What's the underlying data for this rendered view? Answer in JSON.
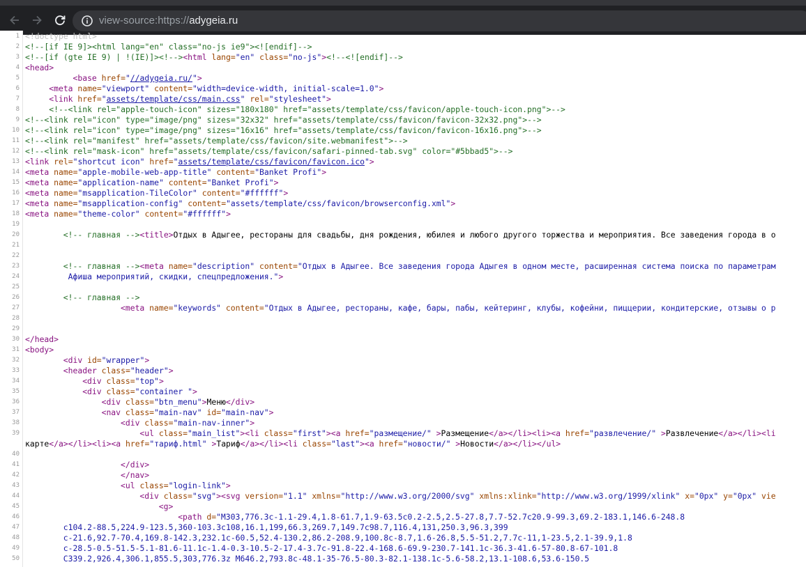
{
  "browser": {
    "url_prefix": "view-source:https://",
    "url_host": "adygeia.ru",
    "back_icon": "arrow-left-icon",
    "forward_icon": "arrow-right-icon",
    "reload_icon": "reload-icon",
    "info_icon": "info-icon"
  },
  "source_lines": [
    {
      "n": "1",
      "indent": 0,
      "parts": [
        [
          "dt",
          "<!doctype html>"
        ]
      ]
    },
    {
      "n": "2",
      "indent": 0,
      "parts": [
        [
          "cm",
          "<!--[if IE 9]><html lang=\"en\" class=\"no-js ie9\"><![endif]-->"
        ]
      ]
    },
    {
      "n": "3",
      "indent": 0,
      "parts": [
        [
          "cm",
          "<!--[if (gte IE 9) | !(IE)]><!-->"
        ],
        [
          "tag",
          "<html "
        ],
        [
          "an",
          "lang="
        ],
        [
          "av",
          "\"en\" "
        ],
        [
          "an",
          "class="
        ],
        [
          "av",
          "\"no-js\""
        ],
        [
          "tag",
          ">"
        ],
        [
          "cm",
          "<!--<![endif]-->"
        ]
      ]
    },
    {
      "n": "4",
      "indent": 0,
      "parts": [
        [
          "tag",
          "<head>"
        ]
      ]
    },
    {
      "n": "5",
      "indent": 10,
      "parts": [
        [
          "tag",
          "<base "
        ],
        [
          "an",
          "href="
        ],
        [
          "av",
          "\""
        ],
        [
          "lk",
          "//adygeia.ru/"
        ],
        [
          "av",
          "\""
        ],
        [
          "tag",
          ">"
        ]
      ]
    },
    {
      "n": "6",
      "indent": 5,
      "parts": [
        [
          "tag",
          "<meta "
        ],
        [
          "an",
          "name="
        ],
        [
          "av",
          "\"viewport\" "
        ],
        [
          "an",
          "content="
        ],
        [
          "av",
          "\"width=device-width, initial-scale=1.0\""
        ],
        [
          "tag",
          ">"
        ]
      ]
    },
    {
      "n": "7",
      "indent": 5,
      "parts": [
        [
          "tag",
          "<link "
        ],
        [
          "an",
          "href="
        ],
        [
          "av",
          "\""
        ],
        [
          "lk",
          "assets/template/css/main.css"
        ],
        [
          "av",
          "\" "
        ],
        [
          "an",
          "rel="
        ],
        [
          "av",
          "\"stylesheet\""
        ],
        [
          "tag",
          ">"
        ]
      ]
    },
    {
      "n": "8",
      "indent": 5,
      "parts": [
        [
          "cm",
          "<!--<link rel=\"apple-touch-icon\" sizes=\"180x180\" href=\"assets/template/css/favicon/apple-touch-icon.png\">-->"
        ]
      ]
    },
    {
      "n": "9",
      "indent": 0,
      "parts": [
        [
          "cm",
          "<!--<link rel=\"icon\" type=\"image/png\" sizes=\"32x32\" href=\"assets/template/css/favicon/favicon-32x32.png\">-->"
        ]
      ]
    },
    {
      "n": "10",
      "indent": 0,
      "parts": [
        [
          "cm",
          "<!--<link rel=\"icon\" type=\"image/png\" sizes=\"16x16\" href=\"assets/template/css/favicon/favicon-16x16.png\">-->"
        ]
      ]
    },
    {
      "n": "11",
      "indent": 0,
      "parts": [
        [
          "cm",
          "<!--<link rel=\"manifest\" href=\"assets/template/css/favicon/site.webmanifest\">-->"
        ]
      ]
    },
    {
      "n": "12",
      "indent": 0,
      "parts": [
        [
          "cm",
          "<!--<link rel=\"mask-icon\" href=\"assets/template/css/favicon/safari-pinned-tab.svg\" color=\"#5bbad5\">-->"
        ]
      ]
    },
    {
      "n": "13",
      "indent": 0,
      "parts": [
        [
          "tag",
          "<link "
        ],
        [
          "an",
          "rel="
        ],
        [
          "av",
          "\"shortcut icon\" "
        ],
        [
          "an",
          "href="
        ],
        [
          "av",
          "\""
        ],
        [
          "lk",
          "assets/template/css/favicon/favicon.ico"
        ],
        [
          "av",
          "\""
        ],
        [
          "tag",
          ">"
        ]
      ]
    },
    {
      "n": "14",
      "indent": 0,
      "parts": [
        [
          "tag",
          "<meta "
        ],
        [
          "an",
          "name="
        ],
        [
          "av",
          "\"apple-mobile-web-app-title\" "
        ],
        [
          "an",
          "content="
        ],
        [
          "av",
          "\"Banket Profi\""
        ],
        [
          "tag",
          ">"
        ]
      ]
    },
    {
      "n": "15",
      "indent": 0,
      "parts": [
        [
          "tag",
          "<meta "
        ],
        [
          "an",
          "name="
        ],
        [
          "av",
          "\"application-name\" "
        ],
        [
          "an",
          "content="
        ],
        [
          "av",
          "\"Banket Profi\""
        ],
        [
          "tag",
          ">"
        ]
      ]
    },
    {
      "n": "16",
      "indent": 0,
      "parts": [
        [
          "tag",
          "<meta "
        ],
        [
          "an",
          "name="
        ],
        [
          "av",
          "\"msapplication-TileColor\" "
        ],
        [
          "an",
          "content="
        ],
        [
          "av",
          "\"#ffffff\""
        ],
        [
          "tag",
          ">"
        ]
      ]
    },
    {
      "n": "17",
      "indent": 0,
      "parts": [
        [
          "tag",
          "<meta "
        ],
        [
          "an",
          "name="
        ],
        [
          "av",
          "\"msapplication-config\" "
        ],
        [
          "an",
          "content="
        ],
        [
          "av",
          "\"assets/template/css/favicon/browserconfig.xml\""
        ],
        [
          "tag",
          ">"
        ]
      ]
    },
    {
      "n": "18",
      "indent": 0,
      "parts": [
        [
          "tag",
          "<meta "
        ],
        [
          "an",
          "name="
        ],
        [
          "av",
          "\"theme-color\" "
        ],
        [
          "an",
          "content="
        ],
        [
          "av",
          "\"#ffffff\""
        ],
        [
          "tag",
          ">"
        ]
      ]
    },
    {
      "n": "19",
      "indent": 0,
      "parts": []
    },
    {
      "n": "20",
      "indent": 8,
      "parts": [
        [
          "cm",
          "<!-- главная -->"
        ],
        [
          "tag",
          "<title>"
        ],
        [
          "tx",
          "Отдых в Адыгее, рестораны для свадьбы, дня рождения, юбилея и любого другого торжества и мероприятия. Все заведения города в о"
        ]
      ]
    },
    {
      "n": "21",
      "indent": 0,
      "parts": []
    },
    {
      "n": "22",
      "indent": 0,
      "parts": []
    },
    {
      "n": "23",
      "indent": 8,
      "parts": [
        [
          "cm",
          "<!-- главная -->"
        ],
        [
          "tag",
          "<meta "
        ],
        [
          "an",
          "name="
        ],
        [
          "av",
          "\"description\" "
        ],
        [
          "an",
          "content="
        ],
        [
          "av",
          "\"Отдых в Адыгее. Все заведения города Адыгея в одном месте, расширенная система поиска по параметрам"
        ]
      ]
    },
    {
      "n": "24",
      "indent": 9,
      "parts": [
        [
          "av",
          "Афиша мероприятий, скидки, спецпредложения.\""
        ],
        [
          "tag",
          ">"
        ]
      ]
    },
    {
      "n": "25",
      "indent": 0,
      "parts": []
    },
    {
      "n": "26",
      "indent": 8,
      "parts": [
        [
          "cm",
          "<!-- главная -->"
        ]
      ]
    },
    {
      "n": "27",
      "indent": 20,
      "parts": [
        [
          "tag",
          "<meta "
        ],
        [
          "an",
          "name="
        ],
        [
          "av",
          "\"keywords\" "
        ],
        [
          "an",
          "content="
        ],
        [
          "av",
          "\"Отдых в Адыгее, рестораны, кафе, бары, пабы, кейтеринг, клубы, кофейни, пиццерии, кондитерские, отзывы о р"
        ]
      ]
    },
    {
      "n": "28",
      "indent": 0,
      "parts": []
    },
    {
      "n": "29",
      "indent": 0,
      "parts": []
    },
    {
      "n": "30",
      "indent": 0,
      "parts": [
        [
          "tag",
          "</head>"
        ]
      ]
    },
    {
      "n": "31",
      "indent": 0,
      "parts": [
        [
          "tag",
          "<body>"
        ]
      ]
    },
    {
      "n": "32",
      "indent": 8,
      "parts": [
        [
          "tag",
          "<div "
        ],
        [
          "an",
          "id="
        ],
        [
          "av",
          "\"wrapper\""
        ],
        [
          "tag",
          ">"
        ]
      ]
    },
    {
      "n": "33",
      "indent": 8,
      "parts": [
        [
          "tag",
          "<header "
        ],
        [
          "an",
          "class="
        ],
        [
          "av",
          "\"header\""
        ],
        [
          "tag",
          ">"
        ]
      ]
    },
    {
      "n": "34",
      "indent": 12,
      "parts": [
        [
          "tag",
          "<div "
        ],
        [
          "an",
          "class="
        ],
        [
          "av",
          "\"top\""
        ],
        [
          "tag",
          ">"
        ]
      ]
    },
    {
      "n": "35",
      "indent": 12,
      "parts": [
        [
          "tag",
          "<div "
        ],
        [
          "an",
          "class="
        ],
        [
          "av",
          "\"container \""
        ],
        [
          "tag",
          ">"
        ]
      ]
    },
    {
      "n": "36",
      "indent": 16,
      "parts": [
        [
          "tag",
          "<div "
        ],
        [
          "an",
          "class="
        ],
        [
          "av",
          "\"btn_menu\""
        ],
        [
          "tag",
          ">"
        ],
        [
          "tx",
          "Меню"
        ],
        [
          "tag",
          "</div>"
        ]
      ]
    },
    {
      "n": "37",
      "indent": 16,
      "parts": [
        [
          "tag",
          "<nav "
        ],
        [
          "an",
          "class="
        ],
        [
          "av",
          "\"main-nav\" "
        ],
        [
          "an",
          "id="
        ],
        [
          "av",
          "\"main-nav\""
        ],
        [
          "tag",
          ">"
        ]
      ]
    },
    {
      "n": "38",
      "indent": 20,
      "parts": [
        [
          "tag",
          "<div "
        ],
        [
          "an",
          "class="
        ],
        [
          "av",
          "\"main-nav-inner\""
        ],
        [
          "tag",
          ">"
        ]
      ]
    },
    {
      "n": "39",
      "indent": 24,
      "parts": [
        [
          "tag",
          "<ul "
        ],
        [
          "an",
          "class="
        ],
        [
          "av",
          "\"main_list\""
        ],
        [
          "tag",
          "><li "
        ],
        [
          "an",
          "class="
        ],
        [
          "av",
          "\"first\""
        ],
        [
          "tag",
          "><a "
        ],
        [
          "an",
          "href="
        ],
        [
          "av",
          "\"размещение/\" "
        ],
        [
          "tag",
          ">"
        ],
        [
          "tx",
          "Размещение"
        ],
        [
          "tag",
          "</a></li><li><a "
        ],
        [
          "an",
          "href="
        ],
        [
          "av",
          "\"развлечение/\" "
        ],
        [
          "tag",
          ">"
        ],
        [
          "tx",
          "Развлечение"
        ],
        [
          "tag",
          "</a></li><li"
        ]
      ]
    },
    {
      "n": "",
      "indent": 0,
      "parts": [
        [
          "tx",
          "карте"
        ],
        [
          "tag",
          "</a></li><li><a "
        ],
        [
          "an",
          "href="
        ],
        [
          "av",
          "\"тариф.html\" "
        ],
        [
          "tag",
          ">"
        ],
        [
          "tx",
          "Тариф"
        ],
        [
          "tag",
          "</a></li><li "
        ],
        [
          "an",
          "class="
        ],
        [
          "av",
          "\"last\""
        ],
        [
          "tag",
          "><a "
        ],
        [
          "an",
          "href="
        ],
        [
          "av",
          "\"новости/\" "
        ],
        [
          "tag",
          ">"
        ],
        [
          "tx",
          "Новости"
        ],
        [
          "tag",
          "</a></li></ul>"
        ]
      ]
    },
    {
      "n": "40",
      "indent": 0,
      "parts": []
    },
    {
      "n": "41",
      "indent": 20,
      "parts": [
        [
          "tag",
          "</div>"
        ]
      ]
    },
    {
      "n": "42",
      "indent": 20,
      "parts": [
        [
          "tag",
          "</nav>"
        ]
      ]
    },
    {
      "n": "43",
      "indent": 20,
      "parts": [
        [
          "tag",
          "<ul "
        ],
        [
          "an",
          "class="
        ],
        [
          "av",
          "\"login-link\""
        ],
        [
          "tag",
          ">"
        ]
      ]
    },
    {
      "n": "44",
      "indent": 24,
      "parts": [
        [
          "tag",
          "<div "
        ],
        [
          "an",
          "class="
        ],
        [
          "av",
          "\"svg\""
        ],
        [
          "tag",
          "><svg "
        ],
        [
          "an",
          "version="
        ],
        [
          "av",
          "\"1.1\" "
        ],
        [
          "an",
          "xmlns="
        ],
        [
          "av",
          "\"http://www.w3.org/2000/svg\" "
        ],
        [
          "an",
          "xmlns:xlink="
        ],
        [
          "av",
          "\"http://www.w3.org/1999/xlink\" "
        ],
        [
          "an",
          "x="
        ],
        [
          "av",
          "\"0px\" "
        ],
        [
          "an",
          "y="
        ],
        [
          "av",
          "\"0px\" "
        ],
        [
          "an",
          "vie"
        ]
      ]
    },
    {
      "n": "45",
      "indent": 28,
      "parts": [
        [
          "tag",
          "<g>"
        ]
      ]
    },
    {
      "n": "46",
      "indent": 32,
      "parts": [
        [
          "tag",
          "<path "
        ],
        [
          "an",
          "d="
        ],
        [
          "av",
          "\"M303,776.3c-1.1-29.4,1.8-61.7,1.9-63.5c0.2-2.5,2.5-27.8,7.7-52.7c20.9-99.3,69.2-183.1,146.6-248.8"
        ]
      ]
    },
    {
      "n": "47",
      "indent": 8,
      "parts": [
        [
          "av",
          "c104.2-88.5,224.9-123.5,360-103.3c108,16.1,199,66.3,269.7,149.7c98.7,116.4,131,250.3,96.3,399"
        ]
      ]
    },
    {
      "n": "48",
      "indent": 8,
      "parts": [
        [
          "av",
          "c-21.6,92.7-70.4,169.8-142.3,232.1c-60.5,52.4-130.2,86.2-208.9,100.8c-8.7,1.6-26.8,5.5-51.2,7.7c-11,1-23.5,2.1-39.9,1.8"
        ]
      ]
    },
    {
      "n": "49",
      "indent": 8,
      "parts": [
        [
          "av",
          "c-28.5-0.5-51.5-5.1-81.6-11.1c-1.4-0.3-10.5-2-17.4-3.7c-91.8-22.4-168.6-69.9-230.7-141.1c-36.3-41.6-57-80.8-67-101.8"
        ]
      ]
    },
    {
      "n": "50",
      "indent": 8,
      "parts": [
        [
          "av",
          "C339.2,926.4,306.1,855.5,303,776.3z M646.2,793.8c-48.1-35-76.5-80.3-82.1-138.1c-5.6-58.2,13.1-108.6,53.6-150.5"
        ]
      ]
    }
  ]
}
